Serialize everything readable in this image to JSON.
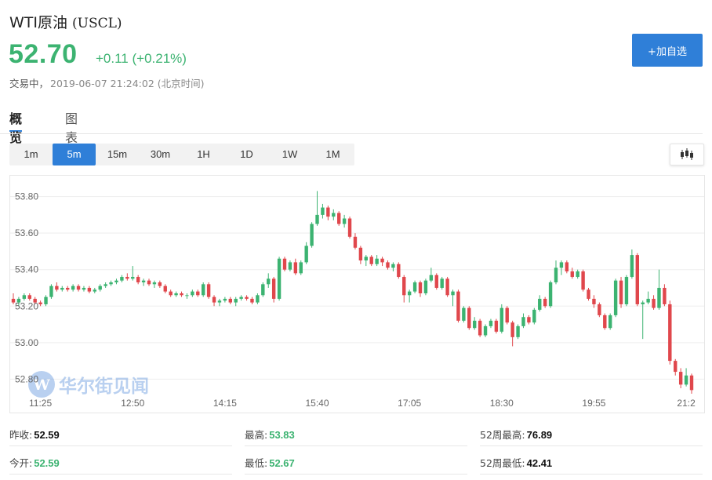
{
  "header": {
    "name": "WTI原油",
    "code": "(USCL)",
    "price": "52.70",
    "change": "+0.11",
    "change_pct": "(+0.21%)",
    "status": "交易中，",
    "timestamp": "2019-06-07 21:24:02 (北京时间)",
    "add_button": "+加自选"
  },
  "tabs": [
    {
      "label": "概览",
      "active": true
    },
    {
      "label": "图表",
      "active": false
    }
  ],
  "periods": [
    {
      "label": "1m",
      "active": false
    },
    {
      "label": "5m",
      "active": true
    },
    {
      "label": "15m",
      "active": false
    },
    {
      "label": "30m",
      "active": false
    },
    {
      "label": "1H",
      "active": false
    },
    {
      "label": "1D",
      "active": false
    },
    {
      "label": "1W",
      "active": false
    },
    {
      "label": "1M",
      "active": false
    }
  ],
  "watermark": "华尔街见闻",
  "colors": {
    "up": "#3cb371",
    "down": "#e0474c",
    "accent": "#2f7fd8"
  },
  "chart_data": {
    "type": "candlestick",
    "ylim": [
      52.72,
      53.88
    ],
    "y_ticks": [
      "53.80",
      "53.60",
      "53.40",
      "53.20",
      "53.00",
      "52.80"
    ],
    "x_ticks": [
      "11:25",
      "12:50",
      "14:15",
      "15:40",
      "17:05",
      "18:30",
      "19:55",
      "21:2"
    ],
    "x_tick_index": [
      5,
      22,
      39,
      56,
      73,
      90,
      107,
      124
    ],
    "candles": [
      [
        53.24,
        53.27,
        53.21,
        53.22
      ],
      [
        53.22,
        53.25,
        53.2,
        53.24
      ],
      [
        53.24,
        53.27,
        53.23,
        53.26
      ],
      [
        53.26,
        53.27,
        53.23,
        53.24
      ],
      [
        53.24,
        53.25,
        53.21,
        53.22
      ],
      [
        53.22,
        53.23,
        53.2,
        53.21
      ],
      [
        53.21,
        53.26,
        53.2,
        53.25
      ],
      [
        53.25,
        53.32,
        53.24,
        53.31
      ],
      [
        53.31,
        53.33,
        53.28,
        53.29
      ],
      [
        53.29,
        53.31,
        53.28,
        53.3
      ],
      [
        53.3,
        53.31,
        53.28,
        53.29
      ],
      [
        53.29,
        53.32,
        53.28,
        53.31
      ],
      [
        53.31,
        53.32,
        53.28,
        53.29
      ],
      [
        53.29,
        53.31,
        53.28,
        53.3
      ],
      [
        53.3,
        53.31,
        53.27,
        53.28
      ],
      [
        53.28,
        53.3,
        53.27,
        53.29
      ],
      [
        53.29,
        53.32,
        53.28,
        53.31
      ],
      [
        53.31,
        53.33,
        53.3,
        53.32
      ],
      [
        53.32,
        53.34,
        53.31,
        53.33
      ],
      [
        53.33,
        53.35,
        53.32,
        53.34
      ],
      [
        53.34,
        53.37,
        53.33,
        53.36
      ],
      [
        53.36,
        53.38,
        53.34,
        53.35
      ],
      [
        53.35,
        53.42,
        53.34,
        53.36
      ],
      [
        53.36,
        53.37,
        53.32,
        53.33
      ],
      [
        53.33,
        53.35,
        53.31,
        53.34
      ],
      [
        53.34,
        53.35,
        53.31,
        53.32
      ],
      [
        53.32,
        53.34,
        53.3,
        53.33
      ],
      [
        53.33,
        53.34,
        53.3,
        53.31
      ],
      [
        53.31,
        53.32,
        53.27,
        53.28
      ],
      [
        53.28,
        53.29,
        53.25,
        53.26
      ],
      [
        53.26,
        53.28,
        53.25,
        53.27
      ],
      [
        53.27,
        53.28,
        53.25,
        53.26
      ],
      [
        53.26,
        53.27,
        53.24,
        53.26
      ],
      [
        53.26,
        53.29,
        53.25,
        53.28
      ],
      [
        53.28,
        53.29,
        53.25,
        53.26
      ],
      [
        53.26,
        53.33,
        53.25,
        53.32
      ],
      [
        53.32,
        53.33,
        53.24,
        53.25
      ],
      [
        53.25,
        53.26,
        53.2,
        53.22
      ],
      [
        53.22,
        53.24,
        53.2,
        53.23
      ],
      [
        53.23,
        53.25,
        53.22,
        53.24
      ],
      [
        53.24,
        53.25,
        53.21,
        53.22
      ],
      [
        53.22,
        53.25,
        53.2,
        53.24
      ],
      [
        53.24,
        53.26,
        53.23,
        53.25
      ],
      [
        53.25,
        53.26,
        53.23,
        53.24
      ],
      [
        53.24,
        53.25,
        53.21,
        53.22
      ],
      [
        53.22,
        53.27,
        53.21,
        53.26
      ],
      [
        53.26,
        53.33,
        53.25,
        53.32
      ],
      [
        53.32,
        53.38,
        53.3,
        53.35
      ],
      [
        53.35,
        53.36,
        53.22,
        53.24
      ],
      [
        53.24,
        53.47,
        53.23,
        53.46
      ],
      [
        53.46,
        53.47,
        53.39,
        53.4
      ],
      [
        53.4,
        53.45,
        53.39,
        53.44
      ],
      [
        53.44,
        53.46,
        53.37,
        53.38
      ],
      [
        53.38,
        53.45,
        53.37,
        53.44
      ],
      [
        53.44,
        53.55,
        53.43,
        53.53
      ],
      [
        53.53,
        53.66,
        53.52,
        53.65
      ],
      [
        53.65,
        53.83,
        53.64,
        53.7
      ],
      [
        53.7,
        53.76,
        53.68,
        53.74
      ],
      [
        53.74,
        53.75,
        53.67,
        53.69
      ],
      [
        53.69,
        53.73,
        53.67,
        53.71
      ],
      [
        53.71,
        53.72,
        53.64,
        53.65
      ],
      [
        53.65,
        53.7,
        53.63,
        53.68
      ],
      [
        53.68,
        53.69,
        53.57,
        53.58
      ],
      [
        53.58,
        53.6,
        53.51,
        53.52
      ],
      [
        53.52,
        53.53,
        53.43,
        53.45
      ],
      [
        53.45,
        53.48,
        53.42,
        53.47
      ],
      [
        53.47,
        53.48,
        53.42,
        53.43
      ],
      [
        53.43,
        53.48,
        53.42,
        53.46
      ],
      [
        53.46,
        53.47,
        53.42,
        53.44
      ],
      [
        53.44,
        53.45,
        53.4,
        53.41
      ],
      [
        53.41,
        53.44,
        53.39,
        53.43
      ],
      [
        53.43,
        53.44,
        53.35,
        53.36
      ],
      [
        53.36,
        53.37,
        53.22,
        53.26
      ],
      [
        53.26,
        53.29,
        53.22,
        53.28
      ],
      [
        53.28,
        53.34,
        53.27,
        53.33
      ],
      [
        53.33,
        53.34,
        53.25,
        53.27
      ],
      [
        53.27,
        53.35,
        53.26,
        53.34
      ],
      [
        53.34,
        53.41,
        53.33,
        53.37
      ],
      [
        53.37,
        53.38,
        53.29,
        53.3
      ],
      [
        53.3,
        53.36,
        53.29,
        53.35
      ],
      [
        53.35,
        53.36,
        53.25,
        53.26
      ],
      [
        53.26,
        53.29,
        53.2,
        53.28
      ],
      [
        53.28,
        53.29,
        53.11,
        53.12
      ],
      [
        53.12,
        53.2,
        53.11,
        53.19
      ],
      [
        53.19,
        53.2,
        53.07,
        53.08
      ],
      [
        53.08,
        53.14,
        53.07,
        53.12
      ],
      [
        53.12,
        53.13,
        53.03,
        53.04
      ],
      [
        53.04,
        53.1,
        53.03,
        53.09
      ],
      [
        53.09,
        53.13,
        53.08,
        53.12
      ],
      [
        53.12,
        53.13,
        53.05,
        53.06
      ],
      [
        53.06,
        53.21,
        53.05,
        53.19
      ],
      [
        53.19,
        53.2,
        53.1,
        53.11
      ],
      [
        53.11,
        53.12,
        52.98,
        53.03
      ],
      [
        53.03,
        53.1,
        53.02,
        53.09
      ],
      [
        53.09,
        53.16,
        53.08,
        53.14
      ],
      [
        53.14,
        53.15,
        53.1,
        53.11
      ],
      [
        53.11,
        53.19,
        53.1,
        53.18
      ],
      [
        53.18,
        53.26,
        53.17,
        53.24
      ],
      [
        53.24,
        53.25,
        53.19,
        53.2
      ],
      [
        53.2,
        53.34,
        53.19,
        53.33
      ],
      [
        53.33,
        53.45,
        53.32,
        53.41
      ],
      [
        53.41,
        53.45,
        53.37,
        53.44
      ],
      [
        53.44,
        53.45,
        53.38,
        53.39
      ],
      [
        53.39,
        53.41,
        53.35,
        53.36
      ],
      [
        53.36,
        53.4,
        53.35,
        53.39
      ],
      [
        53.39,
        53.4,
        53.28,
        53.29
      ],
      [
        53.29,
        53.3,
        53.23,
        53.24
      ],
      [
        53.24,
        53.26,
        53.19,
        53.21
      ],
      [
        53.21,
        53.22,
        53.14,
        53.15
      ],
      [
        53.15,
        53.16,
        53.07,
        53.08
      ],
      [
        53.08,
        53.16,
        53.07,
        53.15
      ],
      [
        53.15,
        53.35,
        53.14,
        53.34
      ],
      [
        53.34,
        53.36,
        53.19,
        53.21
      ],
      [
        53.21,
        53.37,
        53.2,
        53.36
      ],
      [
        53.36,
        53.51,
        53.35,
        53.48
      ],
      [
        53.48,
        53.49,
        53.2,
        53.21
      ],
      [
        53.21,
        53.23,
        53.02,
        53.22
      ],
      [
        53.22,
        53.28,
        53.21,
        53.24
      ],
      [
        53.24,
        53.26,
        53.18,
        53.19
      ],
      [
        53.19,
        53.4,
        53.18,
        53.3
      ],
      [
        53.3,
        53.32,
        53.2,
        53.21
      ],
      [
        53.21,
        53.23,
        52.88,
        52.9
      ],
      [
        52.9,
        52.91,
        52.82,
        52.84
      ],
      [
        52.84,
        52.86,
        52.75,
        52.77
      ],
      [
        52.77,
        52.86,
        52.76,
        52.82
      ],
      [
        52.82,
        52.83,
        52.72,
        52.74
      ]
    ]
  },
  "stats": [
    {
      "label": "昨收:",
      "value": "52.59",
      "tone": "black"
    },
    {
      "label": "最高:",
      "value": "53.83",
      "tone": "green"
    },
    {
      "label": "52周最高:",
      "value": "76.89",
      "tone": "black"
    },
    {
      "label": "今开:",
      "value": "52.59",
      "tone": "green"
    },
    {
      "label": "最低:",
      "value": "52.67",
      "tone": "green"
    },
    {
      "label": "52周最低:",
      "value": "42.41",
      "tone": "black"
    }
  ]
}
